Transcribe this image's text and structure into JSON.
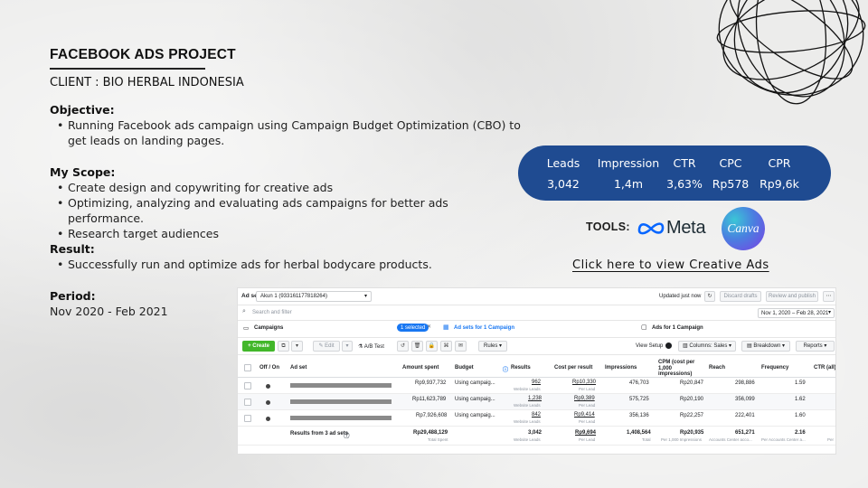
{
  "project": {
    "title": "FACEBOOK ADS PROJECT",
    "client": "CLIENT : BIO HERBAL INDONESIA",
    "objective_heading": "Objective:",
    "objective_items": [
      "Running Facebook ads campaign using Campaign Budget Optimization (CBO) to get leads on landing pages."
    ],
    "scope_heading": "My Scope:",
    "scope_items": [
      "Create design and copywriting for creative ads",
      "Optimizing, analyzing and evaluating ads campaigns for better ads performance.",
      "Research target audiences"
    ],
    "result_heading": "Result:",
    "result_items": [
      "Successfully run and optimize ads for herbal bodycare products."
    ],
    "period_heading": "Period:",
    "period_value": "Nov 2020 - Feb 2021"
  },
  "stats": [
    {
      "label": "Leads",
      "value": "3,042"
    },
    {
      "label": "Impression",
      "value": "1,4m"
    },
    {
      "label": "CTR",
      "value": "3,63%"
    },
    {
      "label": "CPC",
      "value": "Rp578"
    },
    {
      "label": "CPR",
      "value": "Rp9,6k"
    }
  ],
  "tools": {
    "label": "TOOLS:",
    "meta_wordmark": "Meta",
    "canva_wordmark": "Canva",
    "creative_link": "Click here to view Creative Ads"
  },
  "colors": {
    "stats_bg": "#1f4b91",
    "ads_blue": "#1877f2",
    "create_green": "#42b72a"
  },
  "ads_manager": {
    "title": "Ad sets",
    "account": "Akun 1 (933161177818264)",
    "updated": "Updated just now",
    "discard": "Discard drafts",
    "review": "Review and publish",
    "search_placeholder": "Search and filter",
    "date_range": "Nov 1, 2020 – Feb 28, 2021",
    "tab_campaigns": "Campaigns",
    "selected_badge": "1 selected",
    "tab_adsets": "Ad sets for 1 Campaign",
    "tab_ads": "Ads for 1 Campaign",
    "create": "+ Create",
    "edit": "Edit",
    "ab_test": "A/B Test",
    "rules": "Rules",
    "view_setup": "View Setup",
    "columns": "Columns: Sales",
    "breakdown": "Breakdown",
    "reports": "Reports",
    "columns_headers": [
      "Off / On",
      "Ad set",
      "Amount spent",
      "Budget",
      "Results",
      "Cost per result",
      "Impressions",
      "CPM (cost per 1,000 impressions)",
      "Reach",
      "Frequency",
      "CTR (all)"
    ],
    "rows": [
      {
        "amount": "Rp9,937,732",
        "budget": "Using campaig...",
        "results": "962",
        "results_sub": "Website Leads",
        "cpr": "Rp10,330",
        "cpr_sub": "Per Lead",
        "impressions": "476,703",
        "cpm": "Rp20,847",
        "reach": "298,886",
        "frequency": "1.59"
      },
      {
        "amount": "Rp11,623,789",
        "budget": "Using campaig...",
        "results": "1,238",
        "results_sub": "Website Leads",
        "cpr": "Rp9,389",
        "cpr_sub": "Per Lead",
        "impressions": "575,725",
        "cpm": "Rp20,190",
        "reach": "356,099",
        "frequency": "1.62"
      },
      {
        "amount": "Rp7,926,608",
        "budget": "Using campaig...",
        "results": "842",
        "results_sub": "Website Leads",
        "cpr": "Rp9,414",
        "cpr_sub": "Per Lead",
        "impressions": "356,136",
        "cpm": "Rp22,257",
        "reach": "222,401",
        "frequency": "1.60"
      }
    ],
    "total": {
      "label": "Results from 3 ad sets",
      "amount": "Rp29,488,129",
      "amount_sub": "Total Spent",
      "results": "3,042",
      "results_sub": "Website Leads",
      "cpr": "Rp9,694",
      "cpr_sub": "Per Lead",
      "impressions": "1,408,564",
      "impressions_sub": "Total",
      "cpm": "Rp20,935",
      "cpm_sub": "Per 1,000 Impressions",
      "reach": "651,271",
      "reach_sub": "Accounts Center acco...",
      "frequency": "2.16",
      "frequency_sub": "Per Accounts Center a...",
      "ctr_sub": "Per"
    }
  }
}
